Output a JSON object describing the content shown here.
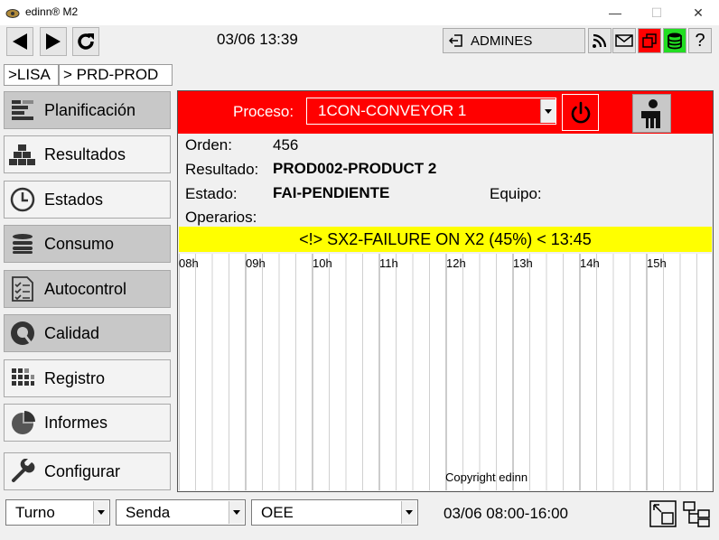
{
  "window": {
    "title": "edinn® M2"
  },
  "toolbar": {
    "datetime": "03/06 13:39",
    "user_label": "ADMINES",
    "help_label": "?"
  },
  "breadcrumb": [
    ">LISA",
    "> PRD-PROD"
  ],
  "sidebar": {
    "items": [
      {
        "label": "Planificación",
        "icon": "planning-icon"
      },
      {
        "label": "Resultados",
        "icon": "results-icon"
      },
      {
        "label": "Estados",
        "icon": "clock-icon"
      },
      {
        "label": "Consumo",
        "icon": "database-icon"
      },
      {
        "label": "Autocontrol",
        "icon": "checklist-icon"
      },
      {
        "label": "Calidad",
        "icon": "quality-icon"
      },
      {
        "label": "Registro",
        "icon": "grid-icon"
      },
      {
        "label": "Informes",
        "icon": "pie-chart-icon"
      },
      {
        "label": "Configurar",
        "icon": "wrench-icon"
      }
    ]
  },
  "process": {
    "label": "Proceso:",
    "selected": "1CON-CONVEYOR 1",
    "header_color": "#ff0000"
  },
  "info": {
    "orden_label": "Orden:",
    "orden_value": "456",
    "resultado_label": "Resultado:",
    "resultado_value": "PROD002-PRODUCT 2",
    "estado_label": "Estado:",
    "estado_value": "FAI-PENDIENTE",
    "equipo_label": "Equipo:",
    "operarios_label": "Operarios:"
  },
  "alarm": {
    "text": "<!> SX2-FAILURE ON X2 (45%) < 13:45",
    "color": "#ffff00"
  },
  "timeline": {
    "hours": [
      "08h",
      "09h",
      "10h",
      "11h",
      "12h",
      "13h",
      "14h",
      "15h"
    ],
    "copyright": "Copyright edinn"
  },
  "bottom": {
    "turno": "Turno",
    "senda": "Senda",
    "oee": "OEE",
    "shift_range": "03/06 08:00-16:00"
  }
}
